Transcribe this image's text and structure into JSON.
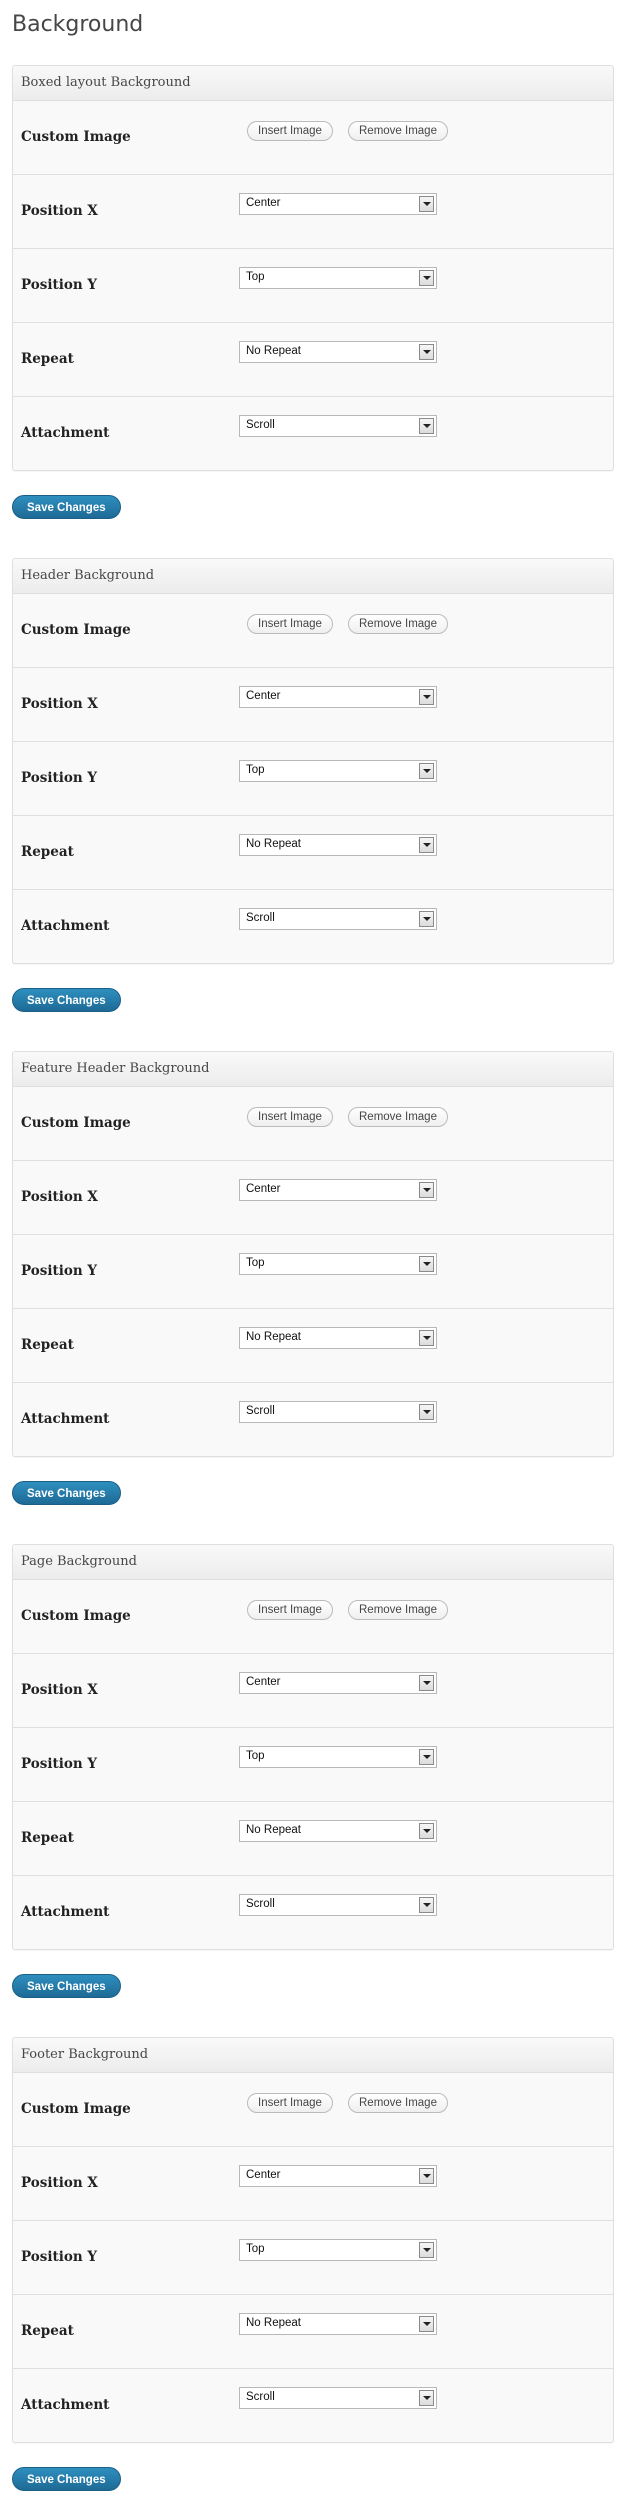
{
  "page": {
    "title": "Background"
  },
  "labels": {
    "custom_image": "Custom Image",
    "position_x": "Position X",
    "position_y": "Position Y",
    "repeat": "Repeat",
    "attachment": "Attachment",
    "insert_image": "Insert Image",
    "remove_image": "Remove Image",
    "save_changes": "Save Changes"
  },
  "sections": [
    {
      "title": "Boxed layout Background",
      "position_x": "Center",
      "position_y": "Top",
      "repeat": "No Repeat",
      "attachment": "Scroll"
    },
    {
      "title": "Header Background",
      "position_x": "Center",
      "position_y": "Top",
      "repeat": "No Repeat",
      "attachment": "Scroll"
    },
    {
      "title": "Feature Header Background",
      "position_x": "Center",
      "position_y": "Top",
      "repeat": "No Repeat",
      "attachment": "Scroll"
    },
    {
      "title": "Page Background",
      "position_x": "Center",
      "position_y": "Top",
      "repeat": "No Repeat",
      "attachment": "Scroll"
    },
    {
      "title": "Footer Background",
      "position_x": "Center",
      "position_y": "Top",
      "repeat": "No Repeat",
      "attachment": "Scroll"
    }
  ],
  "colors": {
    "save_button": "#21759b",
    "panel_background": "#f9f9f9",
    "border": "#dfdfdf"
  }
}
